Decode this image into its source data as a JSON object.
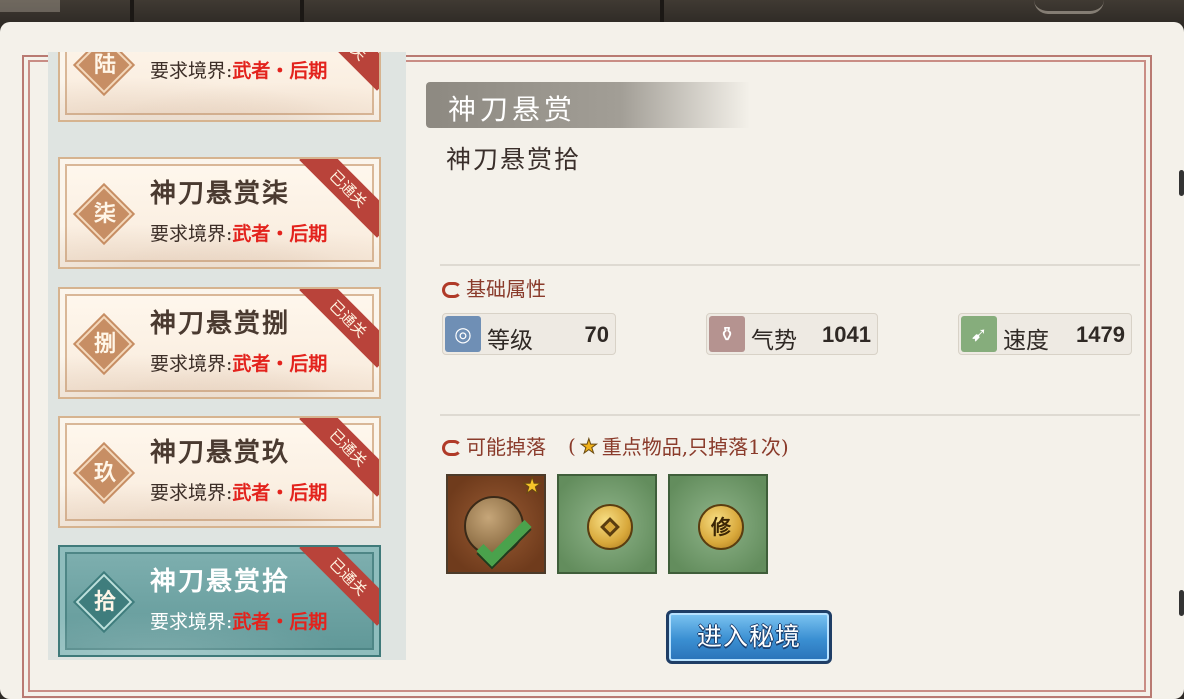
{
  "panel_title": "神刀悬赏",
  "stage_name": "神刀悬赏拾",
  "stages": [
    {
      "num": "陆",
      "title": "",
      "req_label": "要求境界:",
      "req_realm": "武者・后期",
      "badge": "已通关",
      "active": false
    },
    {
      "num": "柒",
      "title": "神刀悬赏柒",
      "req_label": "要求境界:",
      "req_realm": "武者・后期",
      "badge": "已通关",
      "active": false
    },
    {
      "num": "捌",
      "title": "神刀悬赏捌",
      "req_label": "要求境界:",
      "req_realm": "武者・后期",
      "badge": "已通关",
      "active": false
    },
    {
      "num": "玖",
      "title": "神刀悬赏玖",
      "req_label": "要求境界:",
      "req_realm": "武者・后期",
      "badge": "已通关",
      "active": false
    },
    {
      "num": "拾",
      "title": "神刀悬赏拾",
      "req_label": "要求境界:",
      "req_realm": "武者・后期",
      "badge": "已通关",
      "active": true
    }
  ],
  "attributes": {
    "section_title": "基础属性",
    "stats": [
      {
        "label": "等级",
        "value": "70",
        "icon": "level-icon",
        "color": "#6f8fb5"
      },
      {
        "label": "气势",
        "value": "1041",
        "icon": "momentum-icon",
        "color": "#b59390"
      },
      {
        "label": "速度",
        "value": "1479",
        "icon": "speed-icon",
        "color": "#86ad7c"
      }
    ]
  },
  "drops": {
    "section_title": "可能掉落",
    "note_open": "(",
    "note_star": "★",
    "note_text": "重点物品,只掉落1次)",
    "items": [
      {
        "name": "rare-item",
        "starred": true
      },
      {
        "name": "copper-coin",
        "starred": false,
        "glyph": ""
      },
      {
        "name": "cultivation-coin",
        "starred": false,
        "glyph": "修"
      }
    ]
  },
  "enter_button": "进入秘境"
}
